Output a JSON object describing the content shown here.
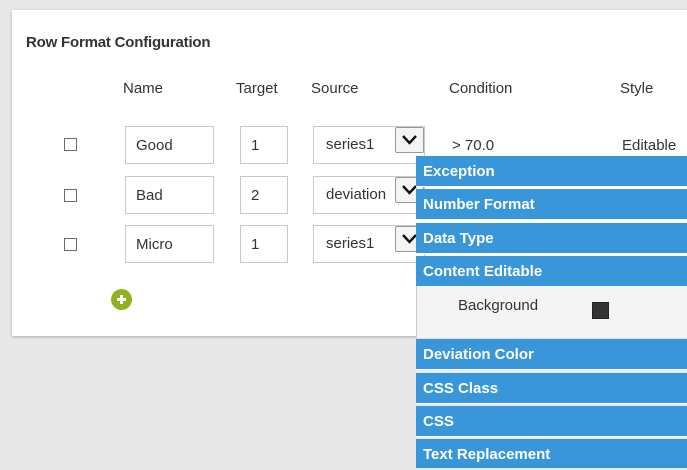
{
  "panel": {
    "title": "Row Format Configuration"
  },
  "columns": {
    "name": "Name",
    "target": "Target",
    "source": "Source",
    "condition": "Condition",
    "style": "Style"
  },
  "rows": [
    {
      "name": "Good",
      "target": "1",
      "source": "series1",
      "condition": "> 70.0",
      "style": "Editable"
    },
    {
      "name": "Bad",
      "target": "2",
      "source": "deviation",
      "condition": "",
      "style": ""
    },
    {
      "name": "Micro",
      "target": "1",
      "source": "series1",
      "condition": "",
      "style": ""
    }
  ],
  "style_menu": {
    "items": [
      "Exception",
      "Number Format",
      "Data Type",
      "Content Editable",
      "Deviation Color",
      "CSS Class",
      "CSS",
      "Text Replacement"
    ],
    "submenu": {
      "background_label": "Background",
      "background_color": "#333333"
    }
  },
  "colors": {
    "menu_blue": "#3997d9",
    "add_green": "#8fb31d"
  },
  "icons": {
    "add": "plus-circle-icon",
    "dropdown": "chevron-down-icon"
  }
}
